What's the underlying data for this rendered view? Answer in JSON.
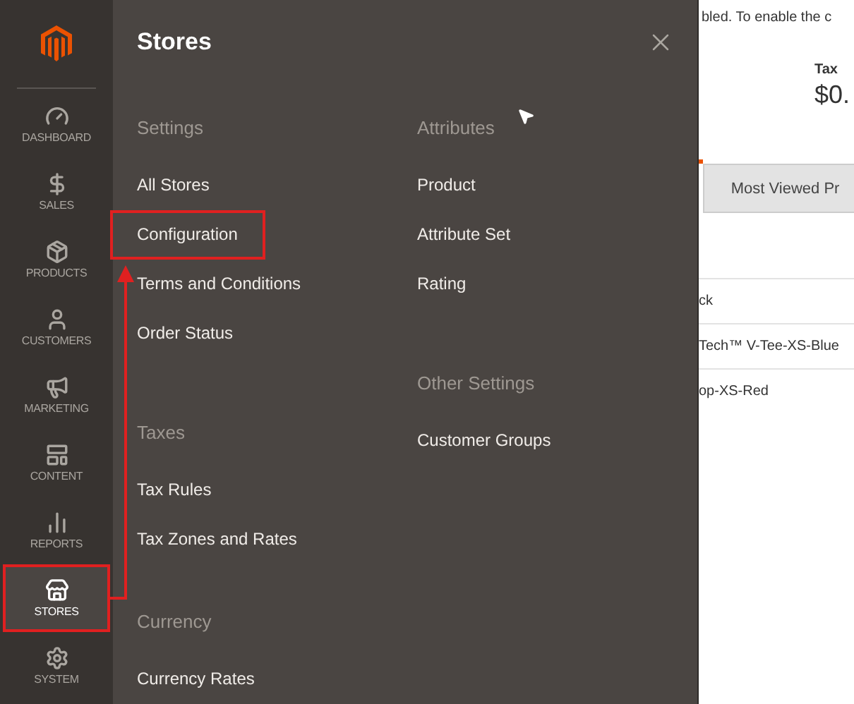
{
  "sidebar": {
    "items": [
      {
        "label": "DASHBOARD",
        "selected": false,
        "highlighted": false
      },
      {
        "label": "SALES",
        "selected": false,
        "highlighted": false
      },
      {
        "label": "PRODUCTS",
        "selected": false,
        "highlighted": false
      },
      {
        "label": "CUSTOMERS",
        "selected": false,
        "highlighted": false
      },
      {
        "label": "MARKETING",
        "selected": false,
        "highlighted": false
      },
      {
        "label": "CONTENT",
        "selected": false,
        "highlighted": false
      },
      {
        "label": "REPORTS",
        "selected": false,
        "highlighted": false
      },
      {
        "label": "STORES",
        "selected": true,
        "highlighted": true
      },
      {
        "label": "SYSTEM",
        "selected": false,
        "highlighted": false
      }
    ]
  },
  "flyout": {
    "title": "Stores",
    "columns": [
      {
        "groups": [
          {
            "heading": "Settings",
            "items": [
              {
                "label": "All Stores",
                "highlighted": false
              },
              {
                "label": "Configuration",
                "highlighted": true
              },
              {
                "label": "Terms and Conditions",
                "highlighted": false
              },
              {
                "label": "Order Status",
                "highlighted": false
              }
            ]
          },
          {
            "heading": "Taxes",
            "items": [
              {
                "label": "Tax Rules",
                "highlighted": false
              },
              {
                "label": "Tax Zones and Rates",
                "highlighted": false
              }
            ]
          },
          {
            "heading": "Currency",
            "items": [
              {
                "label": "Currency Rates",
                "highlighted": false
              }
            ]
          }
        ]
      },
      {
        "groups": [
          {
            "heading": "Attributes",
            "items": [
              {
                "label": "Product",
                "highlighted": false
              },
              {
                "label": "Attribute Set",
                "highlighted": false
              },
              {
                "label": "Rating",
                "highlighted": false
              }
            ]
          },
          {
            "heading": "Other Settings",
            "items": [
              {
                "label": "Customer Groups",
                "highlighted": false
              }
            ]
          }
        ]
      }
    ]
  },
  "background": {
    "notice": "bled. To enable the c",
    "tax_label": "Tax",
    "tax_value": "$0.",
    "tab": "Most Viewed Pr",
    "rows": [
      "ck",
      "Tech™ V-Tee-XS-Blue",
      "op-XS-Red"
    ]
  }
}
